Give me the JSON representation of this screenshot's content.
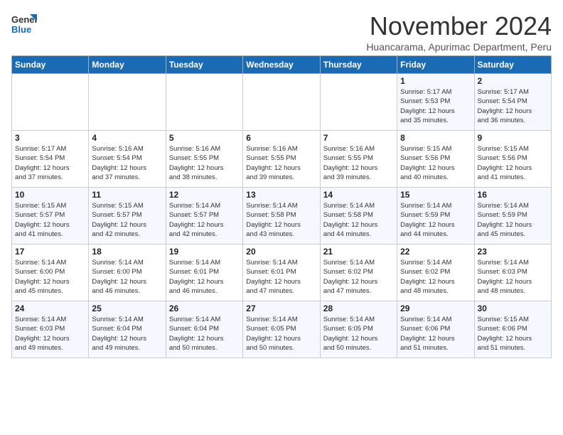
{
  "header": {
    "logo_line1": "General",
    "logo_line2": "Blue",
    "month_title": "November 2024",
    "subtitle": "Huancarama, Apurimac Department, Peru"
  },
  "days_of_week": [
    "Sunday",
    "Monday",
    "Tuesday",
    "Wednesday",
    "Thursday",
    "Friday",
    "Saturday"
  ],
  "weeks": [
    [
      {
        "day": "",
        "info": ""
      },
      {
        "day": "",
        "info": ""
      },
      {
        "day": "",
        "info": ""
      },
      {
        "day": "",
        "info": ""
      },
      {
        "day": "",
        "info": ""
      },
      {
        "day": "1",
        "info": "Sunrise: 5:17 AM\nSunset: 5:53 PM\nDaylight: 12 hours\nand 35 minutes."
      },
      {
        "day": "2",
        "info": "Sunrise: 5:17 AM\nSunset: 5:54 PM\nDaylight: 12 hours\nand 36 minutes."
      }
    ],
    [
      {
        "day": "3",
        "info": "Sunrise: 5:17 AM\nSunset: 5:54 PM\nDaylight: 12 hours\nand 37 minutes."
      },
      {
        "day": "4",
        "info": "Sunrise: 5:16 AM\nSunset: 5:54 PM\nDaylight: 12 hours\nand 37 minutes."
      },
      {
        "day": "5",
        "info": "Sunrise: 5:16 AM\nSunset: 5:55 PM\nDaylight: 12 hours\nand 38 minutes."
      },
      {
        "day": "6",
        "info": "Sunrise: 5:16 AM\nSunset: 5:55 PM\nDaylight: 12 hours\nand 39 minutes."
      },
      {
        "day": "7",
        "info": "Sunrise: 5:16 AM\nSunset: 5:55 PM\nDaylight: 12 hours\nand 39 minutes."
      },
      {
        "day": "8",
        "info": "Sunrise: 5:15 AM\nSunset: 5:56 PM\nDaylight: 12 hours\nand 40 minutes."
      },
      {
        "day": "9",
        "info": "Sunrise: 5:15 AM\nSunset: 5:56 PM\nDaylight: 12 hours\nand 41 minutes."
      }
    ],
    [
      {
        "day": "10",
        "info": "Sunrise: 5:15 AM\nSunset: 5:57 PM\nDaylight: 12 hours\nand 41 minutes."
      },
      {
        "day": "11",
        "info": "Sunrise: 5:15 AM\nSunset: 5:57 PM\nDaylight: 12 hours\nand 42 minutes."
      },
      {
        "day": "12",
        "info": "Sunrise: 5:14 AM\nSunset: 5:57 PM\nDaylight: 12 hours\nand 42 minutes."
      },
      {
        "day": "13",
        "info": "Sunrise: 5:14 AM\nSunset: 5:58 PM\nDaylight: 12 hours\nand 43 minutes."
      },
      {
        "day": "14",
        "info": "Sunrise: 5:14 AM\nSunset: 5:58 PM\nDaylight: 12 hours\nand 44 minutes."
      },
      {
        "day": "15",
        "info": "Sunrise: 5:14 AM\nSunset: 5:59 PM\nDaylight: 12 hours\nand 44 minutes."
      },
      {
        "day": "16",
        "info": "Sunrise: 5:14 AM\nSunset: 5:59 PM\nDaylight: 12 hours\nand 45 minutes."
      }
    ],
    [
      {
        "day": "17",
        "info": "Sunrise: 5:14 AM\nSunset: 6:00 PM\nDaylight: 12 hours\nand 45 minutes."
      },
      {
        "day": "18",
        "info": "Sunrise: 5:14 AM\nSunset: 6:00 PM\nDaylight: 12 hours\nand 46 minutes."
      },
      {
        "day": "19",
        "info": "Sunrise: 5:14 AM\nSunset: 6:01 PM\nDaylight: 12 hours\nand 46 minutes."
      },
      {
        "day": "20",
        "info": "Sunrise: 5:14 AM\nSunset: 6:01 PM\nDaylight: 12 hours\nand 47 minutes."
      },
      {
        "day": "21",
        "info": "Sunrise: 5:14 AM\nSunset: 6:02 PM\nDaylight: 12 hours\nand 47 minutes."
      },
      {
        "day": "22",
        "info": "Sunrise: 5:14 AM\nSunset: 6:02 PM\nDaylight: 12 hours\nand 48 minutes."
      },
      {
        "day": "23",
        "info": "Sunrise: 5:14 AM\nSunset: 6:03 PM\nDaylight: 12 hours\nand 48 minutes."
      }
    ],
    [
      {
        "day": "24",
        "info": "Sunrise: 5:14 AM\nSunset: 6:03 PM\nDaylight: 12 hours\nand 49 minutes."
      },
      {
        "day": "25",
        "info": "Sunrise: 5:14 AM\nSunset: 6:04 PM\nDaylight: 12 hours\nand 49 minutes."
      },
      {
        "day": "26",
        "info": "Sunrise: 5:14 AM\nSunset: 6:04 PM\nDaylight: 12 hours\nand 50 minutes."
      },
      {
        "day": "27",
        "info": "Sunrise: 5:14 AM\nSunset: 6:05 PM\nDaylight: 12 hours\nand 50 minutes."
      },
      {
        "day": "28",
        "info": "Sunrise: 5:14 AM\nSunset: 6:05 PM\nDaylight: 12 hours\nand 50 minutes."
      },
      {
        "day": "29",
        "info": "Sunrise: 5:14 AM\nSunset: 6:06 PM\nDaylight: 12 hours\nand 51 minutes."
      },
      {
        "day": "30",
        "info": "Sunrise: 5:15 AM\nSunset: 6:06 PM\nDaylight: 12 hours\nand 51 minutes."
      }
    ]
  ]
}
